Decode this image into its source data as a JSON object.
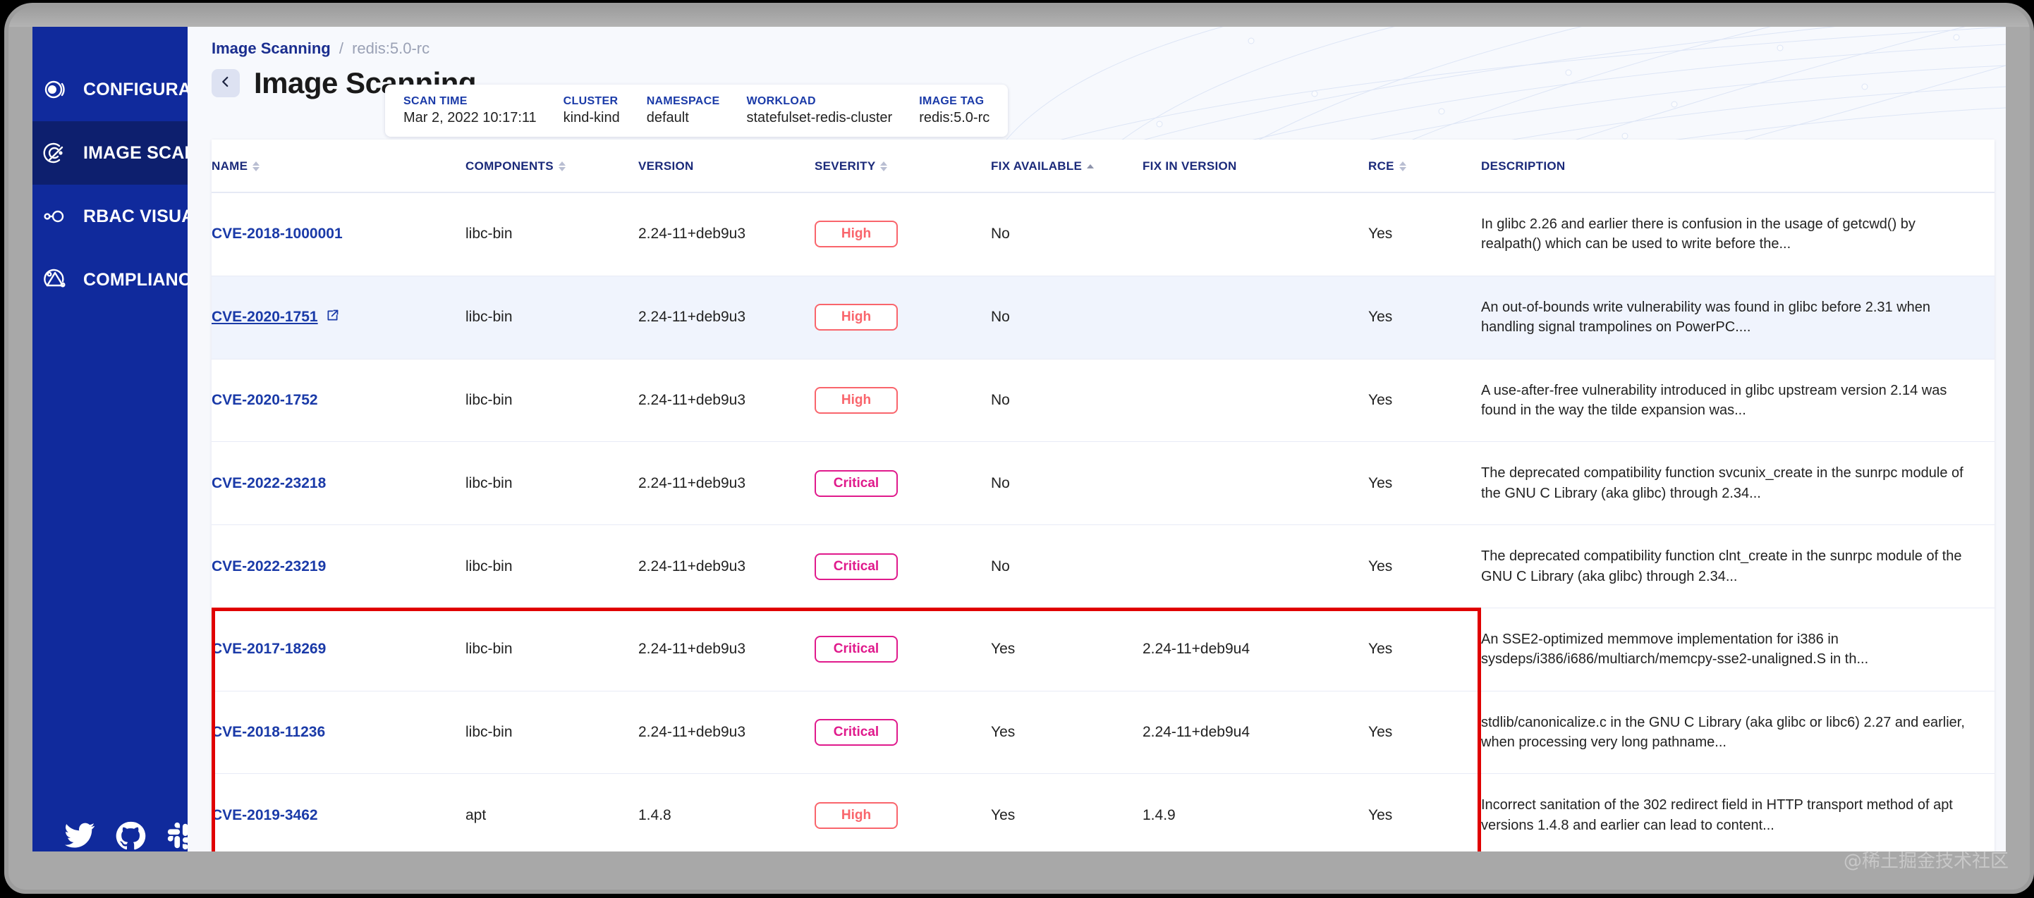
{
  "sidebar": {
    "items": [
      {
        "label": "CONFIGURATION SCANNING",
        "icon": "config-scan-icon",
        "active": false
      },
      {
        "label": "IMAGE SCANNING (beta)",
        "icon": "image-scan-icon",
        "active": true
      },
      {
        "label": "RBAC VISUALIZER (beta)",
        "icon": "rbac-icon",
        "active": false
      },
      {
        "label": "COMPLIANCE",
        "icon": "compliance-icon",
        "active": false
      }
    ],
    "social": [
      "twitter-icon",
      "github-icon",
      "slack-icon"
    ]
  },
  "breadcrumb": {
    "root": "Image Scanning",
    "separator": "/",
    "current": "redis:5.0-rc"
  },
  "header": {
    "title": "Image Scanning",
    "back_icon": "chevron-left-icon",
    "scan_fields": [
      {
        "label": "SCAN TIME",
        "value": "Mar 2, 2022 10:17:11"
      },
      {
        "label": "CLUSTER",
        "value": "kind-kind"
      },
      {
        "label": "NAMESPACE",
        "value": "default"
      },
      {
        "label": "WORKLOAD",
        "value": "statefulset-redis-cluster"
      },
      {
        "label": "IMAGE TAG",
        "value": "redis:5.0-rc"
      }
    ]
  },
  "table": {
    "columns": [
      {
        "label": "NAME",
        "sort": "both"
      },
      {
        "label": "COMPONENTS",
        "sort": "both"
      },
      {
        "label": "VERSION",
        "sort": "none"
      },
      {
        "label": "SEVERITY",
        "sort": "both"
      },
      {
        "label": "FIX AVAILABLE",
        "sort": "asc"
      },
      {
        "label": "FIX IN VERSION",
        "sort": "none"
      },
      {
        "label": "RCE",
        "sort": "both"
      },
      {
        "label": "DESCRIPTION",
        "sort": "none"
      }
    ],
    "rows": [
      {
        "name": "CVE-2018-1000001",
        "external_link": false,
        "hover": false,
        "components": "libc-bin",
        "version": "2.24-11+deb9u3",
        "severity": "High",
        "severity_level": "high",
        "fix_available": "No",
        "fix_in_version": "",
        "rce": "Yes",
        "description": "In glibc 2.26 and earlier there is confusion in the usage of getcwd() by realpath() which can be used to write before the..."
      },
      {
        "name": "CVE-2020-1751",
        "external_link": true,
        "hover": true,
        "components": "libc-bin",
        "version": "2.24-11+deb9u3",
        "severity": "High",
        "severity_level": "high",
        "fix_available": "No",
        "fix_in_version": "",
        "rce": "Yes",
        "description": "An out-of-bounds write vulnerability was found in glibc before 2.31 when handling signal trampolines on PowerPC...."
      },
      {
        "name": "CVE-2020-1752",
        "external_link": false,
        "hover": false,
        "components": "libc-bin",
        "version": "2.24-11+deb9u3",
        "severity": "High",
        "severity_level": "high",
        "fix_available": "No",
        "fix_in_version": "",
        "rce": "Yes",
        "description": "A use-after-free vulnerability introduced in glibc upstream version 2.14 was found in the way the tilde expansion was..."
      },
      {
        "name": "CVE-2022-23218",
        "external_link": false,
        "hover": false,
        "components": "libc-bin",
        "version": "2.24-11+deb9u3",
        "severity": "Critical",
        "severity_level": "critical",
        "fix_available": "No",
        "fix_in_version": "",
        "rce": "Yes",
        "description": "The deprecated compatibility function svcunix_create in the sunrpc module of the GNU C Library (aka glibc) through 2.34..."
      },
      {
        "name": "CVE-2022-23219",
        "external_link": false,
        "hover": false,
        "components": "libc-bin",
        "version": "2.24-11+deb9u3",
        "severity": "Critical",
        "severity_level": "critical",
        "fix_available": "No",
        "fix_in_version": "",
        "rce": "Yes",
        "description": "The deprecated compatibility function clnt_create in the sunrpc module of the GNU C Library (aka glibc) through 2.34..."
      },
      {
        "name": "CVE-2017-18269",
        "external_link": false,
        "hover": false,
        "components": "libc-bin",
        "version": "2.24-11+deb9u3",
        "severity": "Critical",
        "severity_level": "critical",
        "fix_available": "Yes",
        "fix_in_version": "2.24-11+deb9u4",
        "rce": "Yes",
        "description": "An SSE2-optimized memmove implementation for i386 in sysdeps/i386/i686/multiarch/memcpy-sse2-unaligned.S in th..."
      },
      {
        "name": "CVE-2018-11236",
        "external_link": false,
        "hover": false,
        "components": "libc-bin",
        "version": "2.24-11+deb9u3",
        "severity": "Critical",
        "severity_level": "critical",
        "fix_available": "Yes",
        "fix_in_version": "2.24-11+deb9u4",
        "rce": "Yes",
        "description": "stdlib/canonicalize.c in the GNU C Library (aka glibc or libc6) 2.27 and earlier, when processing very long pathname..."
      },
      {
        "name": "CVE-2019-3462",
        "external_link": false,
        "hover": false,
        "components": "apt",
        "version": "1.4.8",
        "severity": "High",
        "severity_level": "high",
        "fix_available": "Yes",
        "fix_in_version": "1.4.9",
        "rce": "Yes",
        "description": "Incorrect sanitation of the 302 redirect field in HTTP transport method of apt versions 1.4.8 and earlier can lead to content..."
      }
    ]
  },
  "annotation": {
    "color": "#e00000"
  },
  "watermark": {
    "text": "@稀土掘金技术社区"
  },
  "colors": {
    "sidebar_bg": "#102a9c",
    "sidebar_active_bg": "#0d1f6e",
    "link_blue": "#1a3aa8",
    "severity_high": "#f9656c",
    "severity_critical": "#e01a8c",
    "annotation_red": "#e00000"
  }
}
